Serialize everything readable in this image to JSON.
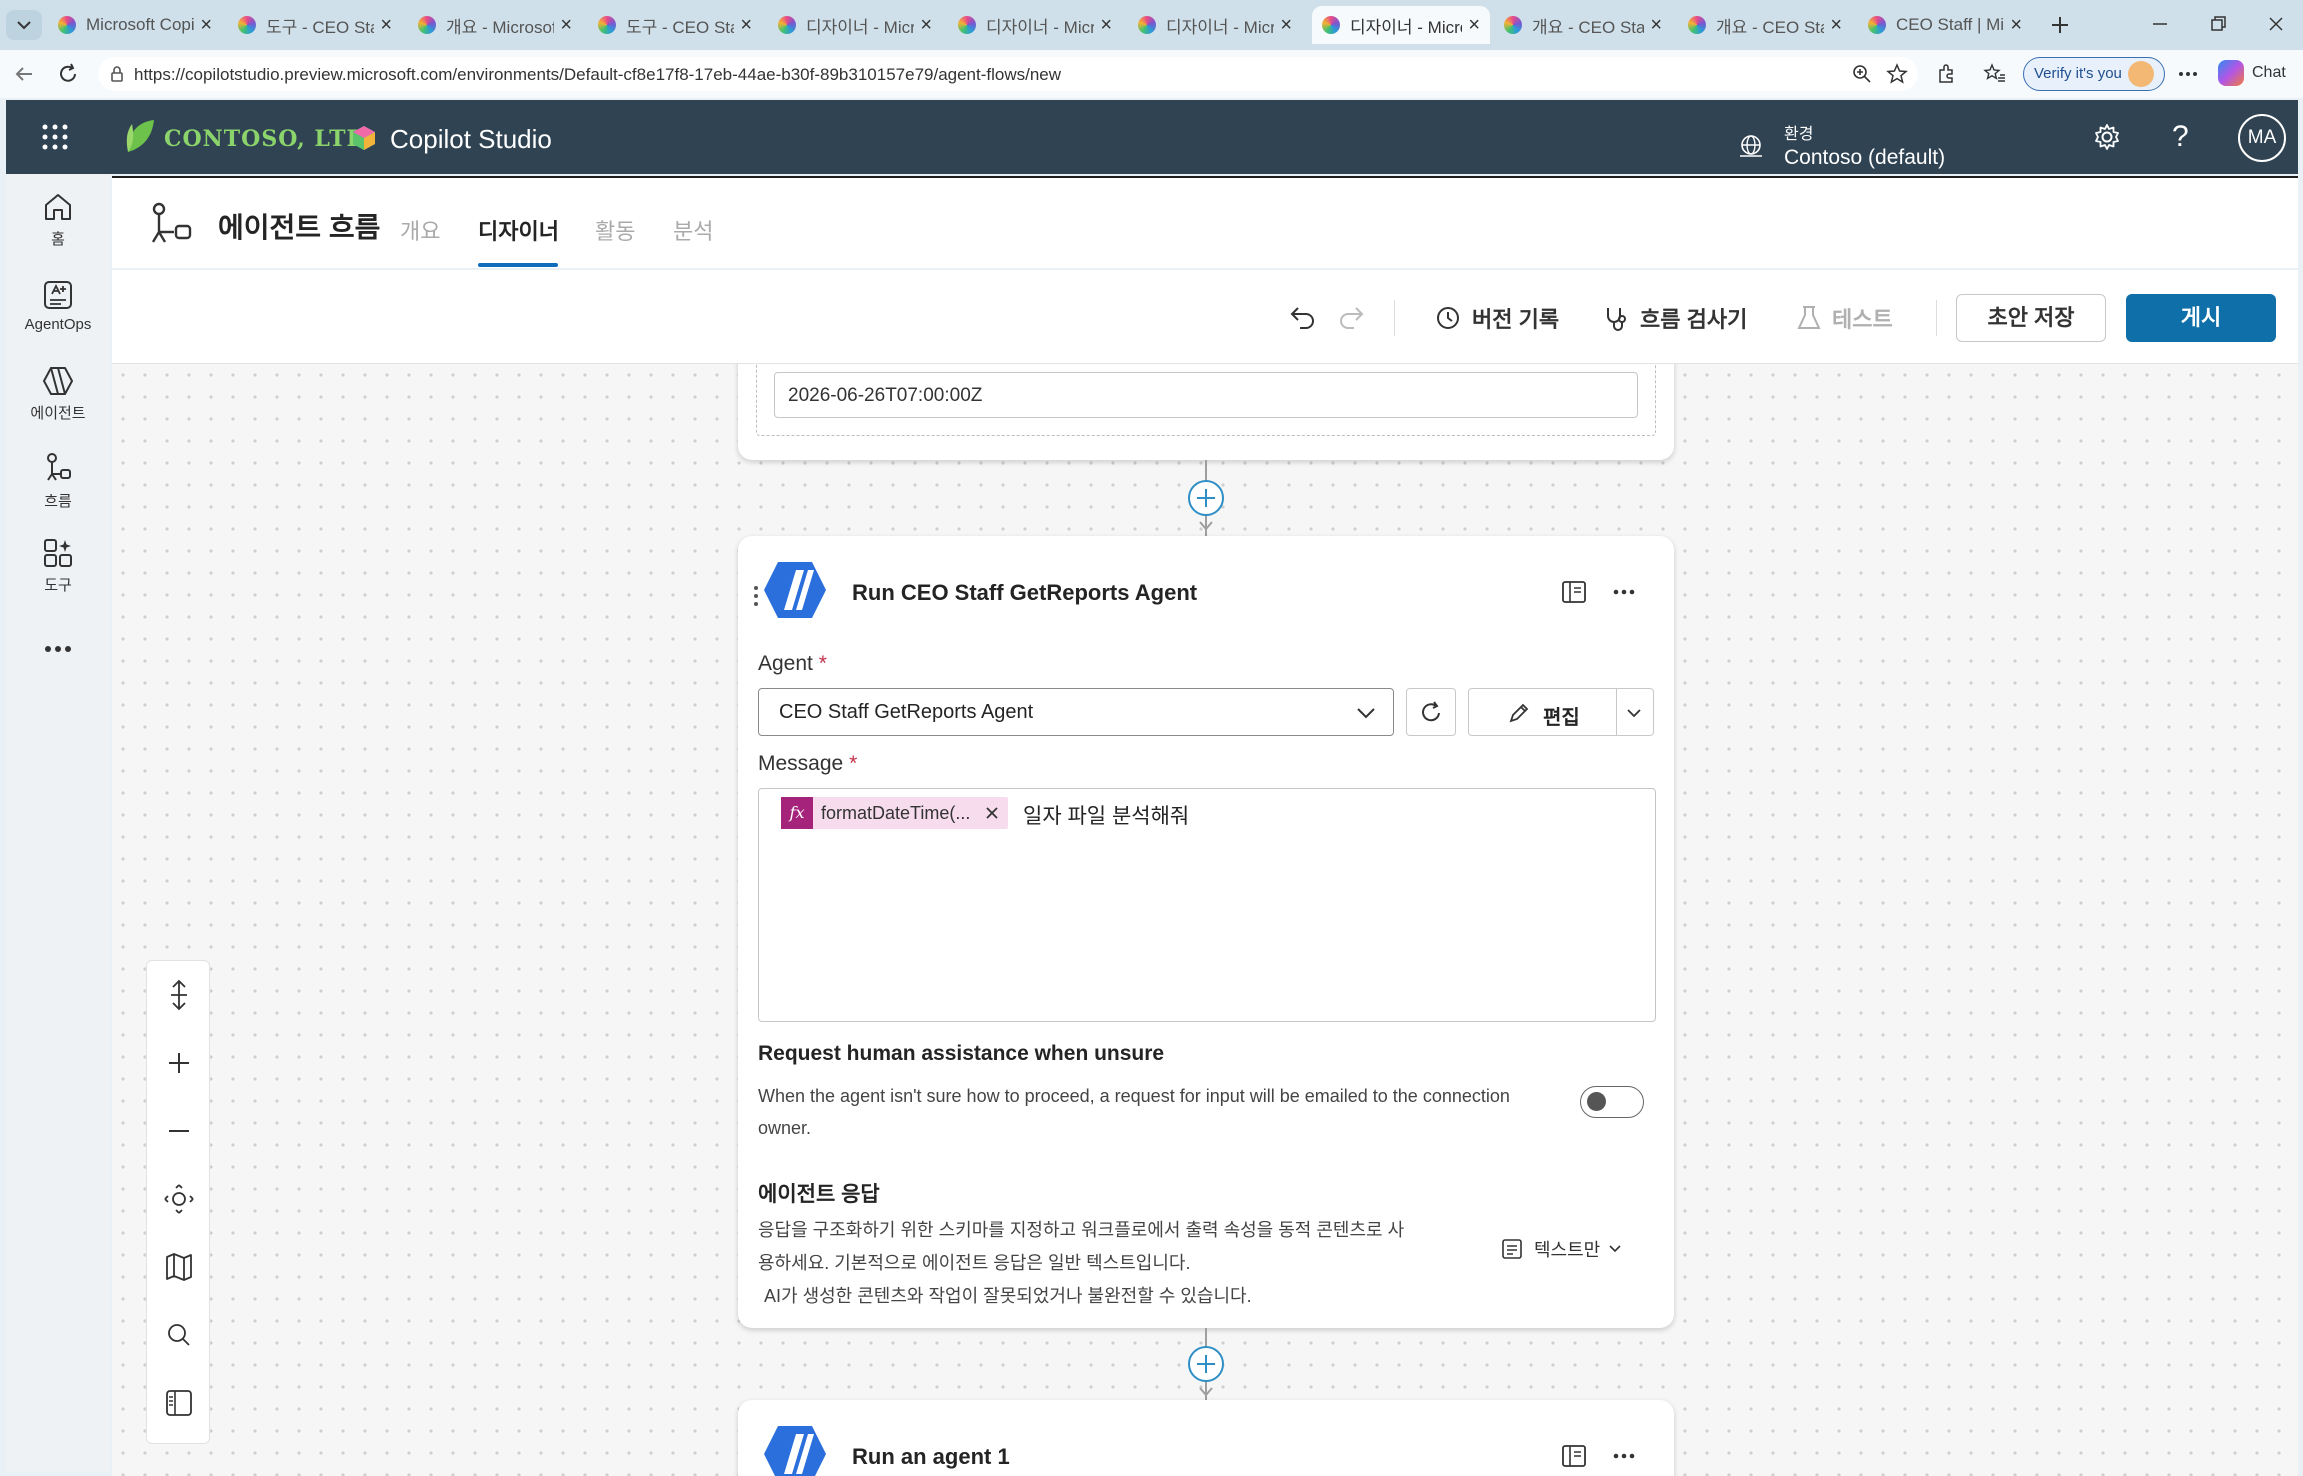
{
  "browser": {
    "tabs": [
      {
        "title": "Microsoft Copilo"
      },
      {
        "title": "도구 - CEO Staff"
      },
      {
        "title": "개요 - Microsoft"
      },
      {
        "title": "도구 - CEO Staff"
      },
      {
        "title": "디자이너 - Micro"
      },
      {
        "title": "디자이너 - Micro"
      },
      {
        "title": "디자이너 - Micro"
      },
      {
        "title": "디자이너 - Micro",
        "active": true
      },
      {
        "title": "개요 - CEO Staff"
      },
      {
        "title": "개요 - CEO Staff"
      },
      {
        "title": "CEO Staff | Micro"
      }
    ],
    "url": "https://copilotstudio.preview.microsoft.com/environments/Default-cf8e17f8-17eb-44ae-b30f-89b310157e79/agent-flows/new",
    "verify_label": "Verify it's you",
    "chat_label": "Chat"
  },
  "app": {
    "org_name": "CONTOSO, LTD.",
    "product_name": "Copilot Studio",
    "env_label": "환경",
    "env_name": "Contoso (default)",
    "avatar_initials": "MA"
  },
  "nav": {
    "items": [
      {
        "label": "홈"
      },
      {
        "label": "AgentOps"
      },
      {
        "label": "에이전트"
      },
      {
        "label": "흐름"
      },
      {
        "label": "도구"
      }
    ]
  },
  "page": {
    "title": "에이전트 흐름",
    "tabs": [
      {
        "label": "개요"
      },
      {
        "label": "디자이너",
        "active": true
      },
      {
        "label": "활동"
      },
      {
        "label": "분석"
      }
    ]
  },
  "toolbar": {
    "version_history": "버전 기록",
    "flow_checker": "흐름 검사기",
    "test": "테스트",
    "save_draft": "초안 저장",
    "publish": "게시"
  },
  "canvas": {
    "prev_card": {
      "date_value": "2026-06-26T07:00:00Z"
    },
    "action_card": {
      "title": "Run CEO Staff GetReports Agent",
      "agent_label": "Agent",
      "agent_required": "*",
      "agent_value": "CEO Staff GetReports Agent",
      "edit_label": "편집",
      "message_label": "Message",
      "message_required": "*",
      "token_icon": "fx",
      "token_label": "formatDateTime(...",
      "message_text": "일자 파일 분석해줘",
      "human_title": "Request human assistance when unsure",
      "human_desc_1": "When the agent isn't sure how to proceed, a request for input will be emailed to the connection",
      "human_desc_2": "owner.",
      "human_toggle": "off",
      "response_title": "에이전트 응답",
      "response_desc_1": "응답을 구조화하기 위한 스키마를 지정하고 워크플로에서 출력 속성을 동적 콘텐츠로 사",
      "response_desc_2": "용하세요. 기본적으로 에이전트 응답은 일반 텍스트입니다.",
      "ai_disclaimer": "AI가 생성한 콘텐츠와 작업이 잘못되었거나 불완전할 수 있습니다.",
      "format_label": "텍스트만"
    },
    "next_card": {
      "title": "Run an agent 1"
    }
  }
}
